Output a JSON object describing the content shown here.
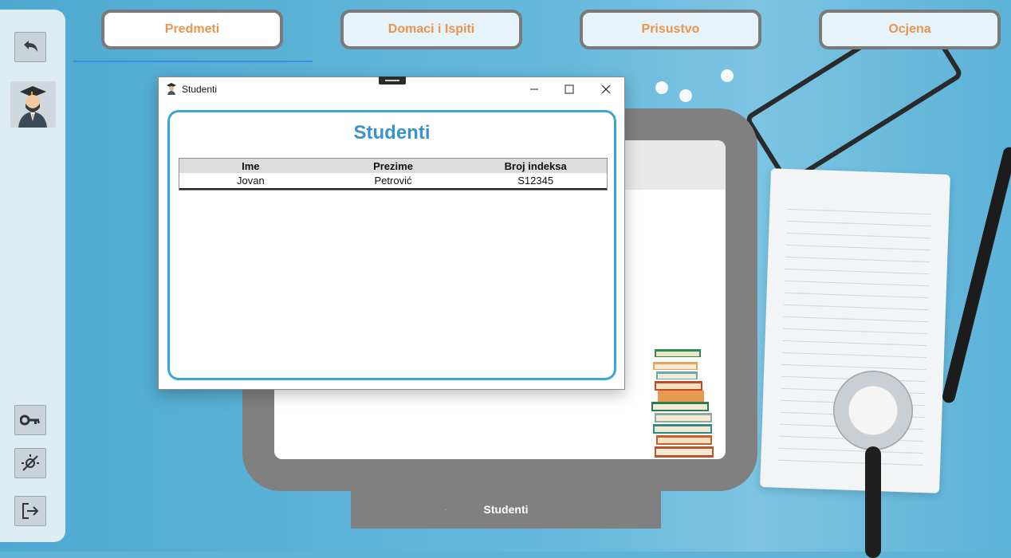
{
  "tabs": [
    {
      "label": "Predmeti",
      "active": true
    },
    {
      "label": "Domaci i Ispiti",
      "active": false
    },
    {
      "label": "Prisustvo",
      "active": false
    },
    {
      "label": "Ocjena",
      "active": false
    }
  ],
  "sidebar": {
    "back_icon": "undo-arrow-icon",
    "avatar_icon": "graduate-avatar-icon",
    "bottom_icons": [
      "key-icon",
      "theme-toggle-icon",
      "logout-icon"
    ]
  },
  "window": {
    "title": "Studenti",
    "icon": "graduate-icon",
    "controls": [
      "minimize-icon",
      "maximize-icon",
      "close-icon"
    ]
  },
  "panel": {
    "heading": "Studenti",
    "columns": [
      "Ime",
      "Prezime",
      "Broj indeksa"
    ],
    "rows": [
      [
        "Jovan",
        "Petrović",
        "S12345"
      ]
    ]
  },
  "monitor": {
    "label": "Studenti",
    "dot": "·"
  },
  "colors": {
    "tab_text": "#e8954f",
    "heading": "#3a93cf",
    "panel_border": "#3ba6cf",
    "tab_underline": "#3b8fe0"
  }
}
